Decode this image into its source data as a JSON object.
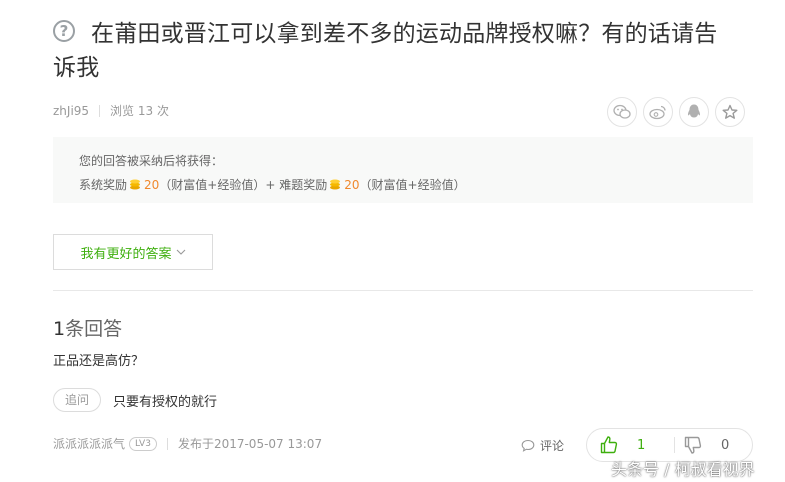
{
  "question": {
    "title_line1": "在莆田或晋江可以拿到差不多的运动品牌授权嘛？有的话请告",
    "title_line2": "诉我",
    "author": "zhJi95",
    "views": "浏览 13 次"
  },
  "share_icons": [
    "wechat-icon",
    "weibo-icon",
    "qq-icon",
    "star-icon"
  ],
  "reward": {
    "intro": "您的回答被采纳后将获得：",
    "system_label": "系统奖励",
    "system_value": "20",
    "system_suffix": "（财富值+经验值）+",
    "difficulty_label": "难题奖励",
    "difficulty_value": "20",
    "difficulty_suffix": "（财富值+经验值）"
  },
  "better_answer_label": "我有更好的答案",
  "answers": {
    "count": "1",
    "count_label": "条回答",
    "text": "正品还是高仿？",
    "followup_tag": "追问",
    "followup_text": "只要有授权的就行",
    "author": "派派派派派气",
    "level": "LV3",
    "published": "发布于2017-05-07 13:07",
    "comment_label": "评论",
    "upvotes": "1",
    "downvotes": "0"
  },
  "watermark": "头条号 / 柯叔看视界",
  "colors": {
    "accent_green": "#3eaf0e",
    "reward_orange": "#f0892e",
    "coin_gold": "#f5b800"
  }
}
